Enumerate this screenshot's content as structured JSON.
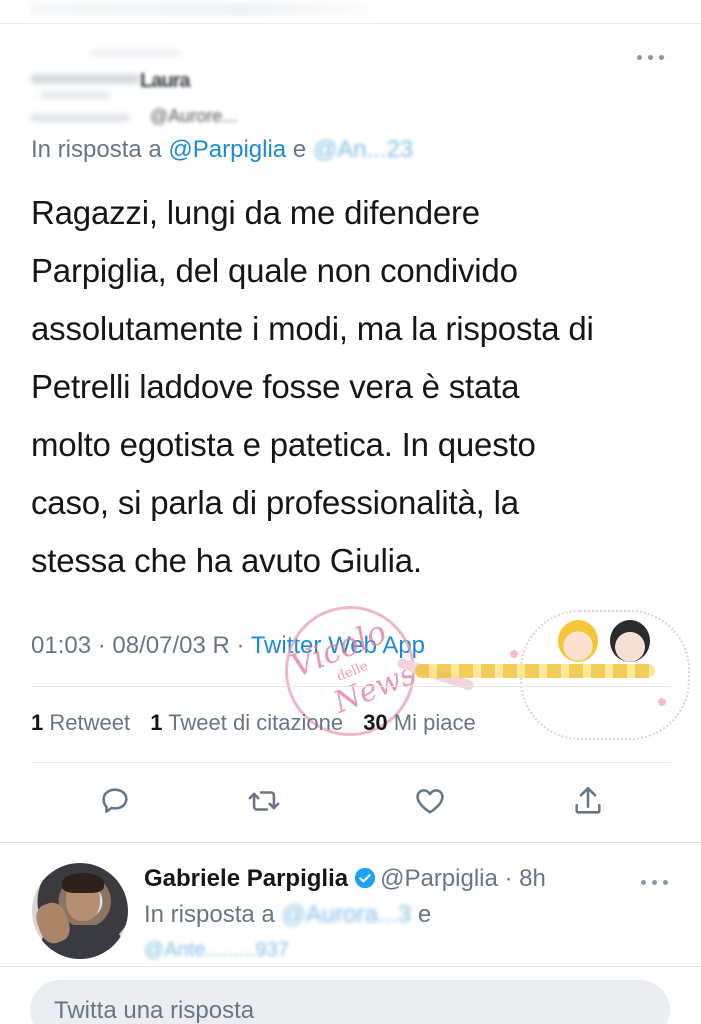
{
  "tweet": {
    "author": {
      "name": "Laura",
      "handle": "@Aurore..."
    },
    "reply_to": {
      "prefix": "In risposta a",
      "mention": "@Parpiglia",
      "connector": "e",
      "second_mention_obscured": "@An...23"
    },
    "text_lines": [
      "Ragazzi, lungi da me difendere",
      "Parpiglia, del quale non condivido",
      "assolutamente i modi, ma la risposta di",
      "Petrelli laddove fosse vera è stata",
      "molto egotista e patetica. In questo",
      "caso, si parla di professionalità, la",
      "stessa che ha avuto Giulia."
    ],
    "timestamp": "01:03 · 08/07/03 R",
    "via_separator": "·",
    "source_app": "Twitter Web App",
    "stats": [
      {
        "count": "1",
        "label": "Retweet"
      },
      {
        "count": "1",
        "label": "Tweet di citazione"
      },
      {
        "count": "30",
        "label": "Mi piace"
      }
    ],
    "actions": [
      "reply-icon",
      "retweet-icon",
      "like-icon",
      "share-icon"
    ]
  },
  "watermark": {
    "line1": "Vicolo",
    "line2": "delle",
    "line3": "News"
  },
  "reply": {
    "name": "Gabriele Parpiglia",
    "handle": "@Parpiglia",
    "time": "· 8h",
    "reply_prefix": "In risposta a",
    "reply_mention_obscured": "@Aurora...3",
    "reply_connector": "e",
    "second_mention_obscured": "@Ante.........937"
  },
  "composer": {
    "placeholder": "Twitta una risposta"
  },
  "colors": {
    "link": "#1b8bd6",
    "secondary_text": "#657786",
    "primary_text": "#14171a",
    "composer_bg": "#eaeef1",
    "verified": "#1da1f2"
  }
}
